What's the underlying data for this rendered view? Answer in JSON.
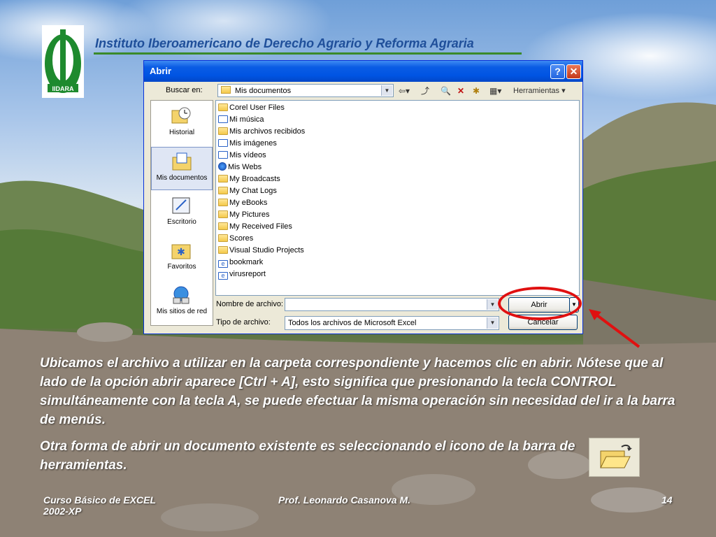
{
  "slide": {
    "institute_title": "Instituto Iberoamericano de Derecho Agrario y Reforma Agraria",
    "logo_text": "IIDARA",
    "paragraph1": "Ubicamos el archivo a utilizar en la carpeta correspondiente y hacemos clic en abrir. Nótese que al lado de la opción abrir aparece [Ctrl + A], esto significa que presionando la tecla CONTROL simultáneamente con la tecla A, se puede efectuar la misma operación sin necesidad del ir a la barra de menús.",
    "paragraph2": "Otra forma de abrir un documento existente es seleccionando el icono de la barra de herramientas.",
    "footer_left": "Curso Básico de EXCEL 2002-XP",
    "footer_center": "Prof. Leonardo Casanova M.",
    "footer_page": "14"
  },
  "dialog": {
    "title": "Abrir",
    "help_glyph": "?",
    "close_glyph": "✕",
    "look_in_label": "Buscar en:",
    "look_in_value": "Mis documentos",
    "tools_label": "Herramientas",
    "places": [
      {
        "label": "Historial",
        "icon": "history-icon"
      },
      {
        "label": "Mis documentos",
        "icon": "my-documents-icon"
      },
      {
        "label": "Escritorio",
        "icon": "desktop-icon"
      },
      {
        "label": "Favoritos",
        "icon": "favorites-icon"
      },
      {
        "label": "Mis sitios de red",
        "icon": "network-places-icon"
      }
    ],
    "files": [
      {
        "name": "Corel User Files",
        "icon": "folder-icon"
      },
      {
        "name": "Mi música",
        "icon": "music-folder-icon"
      },
      {
        "name": "Mis archivos recibidos",
        "icon": "folder-icon"
      },
      {
        "name": "Mis imágenes",
        "icon": "pictures-folder-icon"
      },
      {
        "name": "Mis vídeos",
        "icon": "videos-folder-icon"
      },
      {
        "name": "Mis Webs",
        "icon": "webs-folder-icon"
      },
      {
        "name": "My Broadcasts",
        "icon": "folder-icon"
      },
      {
        "name": "My Chat Logs",
        "icon": "folder-icon"
      },
      {
        "name": "My eBooks",
        "icon": "folder-icon"
      },
      {
        "name": "My Pictures",
        "icon": "folder-icon"
      },
      {
        "name": "My Received Files",
        "icon": "folder-icon"
      },
      {
        "name": "Scores",
        "icon": "folder-icon"
      },
      {
        "name": "Visual Studio Projects",
        "icon": "folder-icon"
      },
      {
        "name": "bookmark",
        "icon": "web-file-icon"
      },
      {
        "name": "virusreport",
        "icon": "web-file-icon"
      }
    ],
    "filename_label": "Nombre de archivo:",
    "filename_value": "",
    "filetype_label": "Tipo de archivo:",
    "filetype_value": "Todos los archivos de Microsoft Excel",
    "open_button": "Abrir",
    "cancel_button": "Cancelar"
  }
}
